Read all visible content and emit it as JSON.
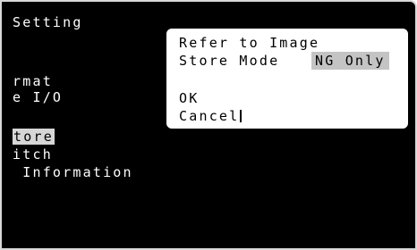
{
  "screen_title": "Setting",
  "menu_items": [
    {
      "label": "rmat"
    },
    {
      "label": "e I/O"
    },
    {
      "label": "tore"
    },
    {
      "label": "itch"
    },
    {
      "label": " Information"
    }
  ],
  "dialog": {
    "title": "Refer to Image",
    "store_mode_label": "Store Mode",
    "store_mode_value": "NG Only",
    "ok_label": "OK",
    "cancel_label": "Cancel"
  },
  "colors": {
    "background": "#000000",
    "text": "#ffffff",
    "dialog_background": "#ffffff",
    "highlight": "#d6d6d6",
    "value_highlight": "#c4c4c4"
  }
}
